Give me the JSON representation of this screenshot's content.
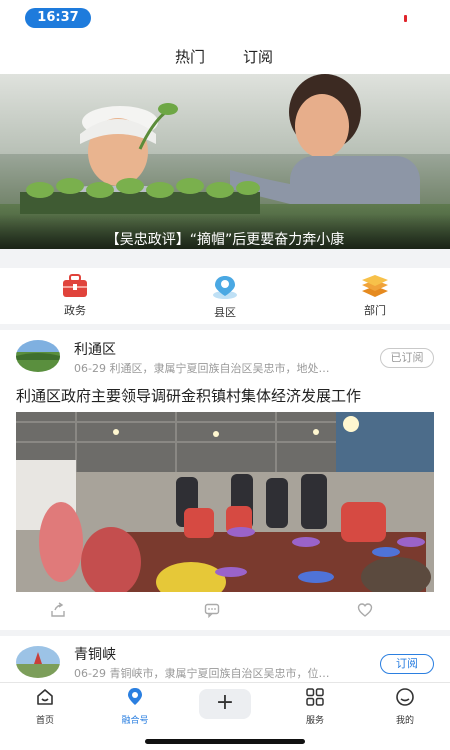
{
  "status_bar": {
    "time": "16:37"
  },
  "top_tabs": [
    {
      "label": "热门"
    },
    {
      "label": "订阅"
    }
  ],
  "banner": {
    "caption": "【吴忠政评】“摘帽”后更要奋力奔小康"
  },
  "categories": [
    {
      "label": "政务",
      "icon": "briefcase-icon"
    },
    {
      "label": "县区",
      "icon": "location-pin-icon"
    },
    {
      "label": "部门",
      "icon": "layers-icon"
    }
  ],
  "feed": [
    {
      "source": "利通区",
      "meta": "06-29 利通区，隶属宁夏回族自治区吴忠市，地处…",
      "subscribe_label": "已订阅",
      "headline": "利通区政府主要领导调研金积镇村集体经济发展工作"
    },
    {
      "source": "青铜峡",
      "meta": "06-29 青铜峡市，隶属宁夏回族自治区吴忠市，位…",
      "subscribe_label": "订阅"
    }
  ],
  "bottom_nav": [
    {
      "label": "首页",
      "icon": "home-icon"
    },
    {
      "label": "融合号",
      "icon": "location-pin-icon"
    },
    {
      "label": "",
      "icon": "plus-icon"
    },
    {
      "label": "服务",
      "icon": "grid-icon"
    },
    {
      "label": "我的",
      "icon": "profile-icon"
    }
  ],
  "colors": {
    "accent": "#2b7fe0",
    "status_pill": "#1e7bdc",
    "category_red": "#e0433b",
    "category_orange": "#f0a33a"
  }
}
